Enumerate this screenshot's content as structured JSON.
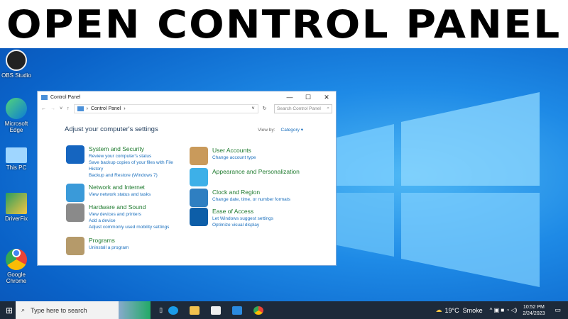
{
  "banner": {
    "title": "OPEN CONTROL PANEL"
  },
  "desktop": {
    "icons": [
      "OBS Studio",
      "Microsoft Edge",
      "This PC",
      "DriverFix",
      "Google Chrome"
    ]
  },
  "window": {
    "title": "Control Panel",
    "minimize": "—",
    "maximize": "☐",
    "close": "✕",
    "breadcrumb": "Control Panel",
    "search_placeholder": "Search Control Panel",
    "heading": "Adjust your computer's settings",
    "view_by_label": "View by:",
    "view_by_value": "Category ▾",
    "left": [
      {
        "title": "System and Security",
        "links": [
          "Review your computer's status",
          "Save backup copies of your files with File History",
          "Backup and Restore (Windows 7)"
        ],
        "color": "#1565c0"
      },
      {
        "title": "Network and Internet",
        "links": [
          "View network status and tasks"
        ],
        "color": "#3a9ad9"
      },
      {
        "title": "Hardware and Sound",
        "links": [
          "View devices and printers",
          "Add a device",
          "Adjust commonly used mobility settings"
        ],
        "color": "#8a8a8a"
      },
      {
        "title": "Programs",
        "links": [
          "Uninstall a program"
        ],
        "color": "#b59a6a"
      }
    ],
    "right": [
      {
        "title": "User Accounts",
        "links": [
          "Change account type"
        ],
        "color": "#c99a5b"
      },
      {
        "title": "Appearance and Personalization",
        "links": [],
        "color": "#3db0e8"
      },
      {
        "title": "Clock and Region",
        "links": [
          "Change date, time, or number formats"
        ],
        "color": "#2f7fc1"
      },
      {
        "title": "Ease of Access",
        "links": [
          "Let Windows suggest settings",
          "Optimize visual display"
        ],
        "color": "#0d5ea8"
      }
    ]
  },
  "taskbar": {
    "search": "Type here to search",
    "weather": "19°C  Smoke",
    "time": "10:52 PM",
    "date": "2/24/2023"
  }
}
